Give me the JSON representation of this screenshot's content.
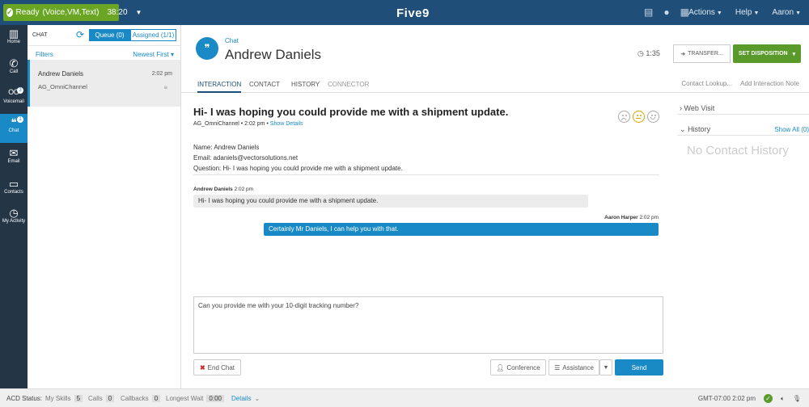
{
  "topbar": {
    "status": "Ready",
    "channels": "(Voice,VM,Text)",
    "timer": "38:20",
    "logo": "Five9",
    "menu": [
      "Actions",
      "Help",
      "Aaron"
    ]
  },
  "leftnav": {
    "items": [
      {
        "label": "Home",
        "icon": "home-icon"
      },
      {
        "label": "Call",
        "icon": "phone-icon"
      },
      {
        "label": "Voicemail",
        "icon": "voicemail-icon",
        "badge": "3"
      },
      {
        "label": "Chat",
        "icon": "chat-icon",
        "badge": "1"
      },
      {
        "label": "Email",
        "icon": "envelope-icon"
      },
      {
        "label": "Contacts",
        "icon": "folder-icon"
      },
      {
        "label": "My Activity",
        "icon": "clock-icon"
      }
    ]
  },
  "listpanel": {
    "title": "CHAT",
    "queue_tab": "Queue (0)",
    "assigned_tab": "Assigned (1/1)",
    "filters": "Filters",
    "sort": "Newest First",
    "items": [
      {
        "name": "Andrew Daniels",
        "time": "2:02 pm",
        "skill": "AG_OmniChannel"
      }
    ]
  },
  "header": {
    "type": "Chat",
    "name": "Andrew Daniels",
    "duration": "1:35",
    "transfer": "TRANSFER...",
    "set_disposition": "SET DISPOSITION"
  },
  "tabs": [
    "INTERACTION",
    "CONTACT",
    "HISTORY",
    "CONNECTOR"
  ],
  "right_links": [
    "Contact Lookup...",
    "Add Interaction Note"
  ],
  "interaction": {
    "subject": "Hi- I was hoping you could provide me with a shipment update.",
    "skill": "AG_OmniChannel",
    "time": "2:02 pm",
    "show_details": "Show Details",
    "fields": [
      {
        "label": "Name:",
        "value": "Andrew Daniels"
      },
      {
        "label": "Email:",
        "value": "adaniels@vectorsolutions.net"
      },
      {
        "label": "Question:",
        "value": "Hi- I was hoping you could provide me with a shipment update."
      }
    ],
    "messages": [
      {
        "sender": "Andrew Daniels",
        "time": "2:02 pm",
        "text": "Hi- I was hoping you could provide me with a shipment update."
      },
      {
        "sender": "Aaron Harper",
        "time": "2:02 pm",
        "text": "Certainly Mr Daniels, I can help you with that."
      }
    ],
    "compose_text": "Can you provide me with your 10-digit tracking number?",
    "buttons": {
      "end_chat": "End Chat",
      "conference": "Conference",
      "assistance": "Assistance",
      "send": "Send"
    }
  },
  "rightpanel": {
    "web_visit": "Web Visit",
    "history": "History",
    "show_all": "Show All (0)",
    "empty": "No Contact History"
  },
  "statusbar": {
    "acd_label": "ACD Status:",
    "my_skills_label": "My Skills",
    "my_skills": "5",
    "calls_label": "Calls",
    "calls": "0",
    "callbacks_label": "Callbacks",
    "callbacks": "0",
    "longest_wait_label": "Longest Wait",
    "longest_wait": "0:00",
    "details": "Details",
    "timezone_time": "GMT-07:00 2:02 pm"
  },
  "colors": {
    "topbar": "#1f4e79",
    "ready": "#6aa624",
    "accent": "#1a8ac6",
    "disposition": "#5a9a2a"
  }
}
